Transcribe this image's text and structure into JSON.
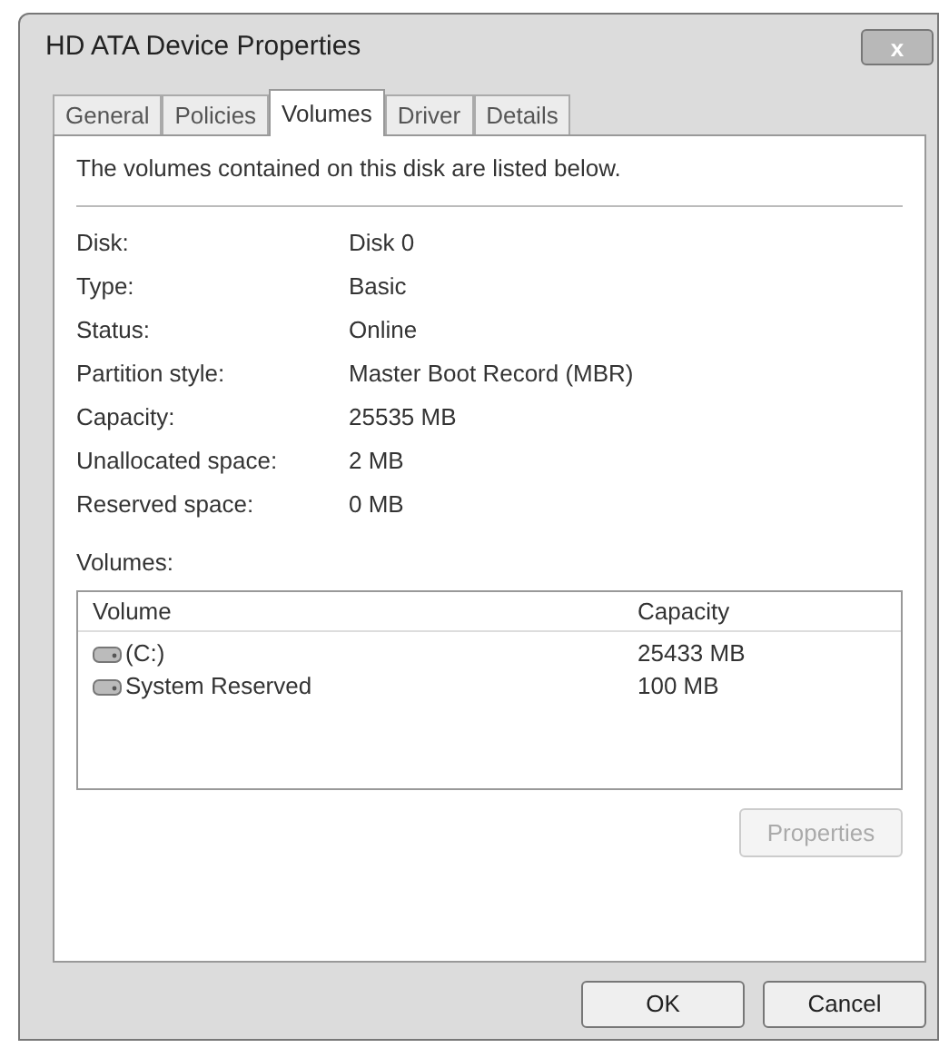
{
  "window": {
    "title": "HD ATA Device Properties",
    "close_label": "x"
  },
  "tabs": [
    {
      "label": "General",
      "selected": false
    },
    {
      "label": "Policies",
      "selected": false
    },
    {
      "label": "Volumes",
      "selected": true
    },
    {
      "label": "Driver",
      "selected": false
    },
    {
      "label": "Details",
      "selected": false
    }
  ],
  "intro": "The volumes contained on this disk are listed below.",
  "properties": [
    {
      "label": "Disk:",
      "value": "Disk 0"
    },
    {
      "label": "Type:",
      "value": "Basic"
    },
    {
      "label": "Status:",
      "value": "Online"
    },
    {
      "label": "Partition style:",
      "value": "Master Boot Record (MBR)"
    },
    {
      "label": "Capacity:",
      "value": "25535 MB"
    },
    {
      "label": "Unallocated space:",
      "value": "2 MB"
    },
    {
      "label": "Reserved space:",
      "value": "0 MB"
    }
  ],
  "volumes": {
    "label": "Volumes:",
    "columns": [
      "Volume",
      "Capacity"
    ],
    "rows": [
      {
        "volume": "(C:)",
        "capacity": "25433 MB"
      },
      {
        "volume": "System Reserved",
        "capacity": "100 MB"
      }
    ]
  },
  "properties_button": {
    "label": "Properties",
    "disabled": true
  },
  "buttons": [
    {
      "label": "OK",
      "disabled": false
    },
    {
      "label": "Cancel",
      "disabled": false
    }
  ]
}
